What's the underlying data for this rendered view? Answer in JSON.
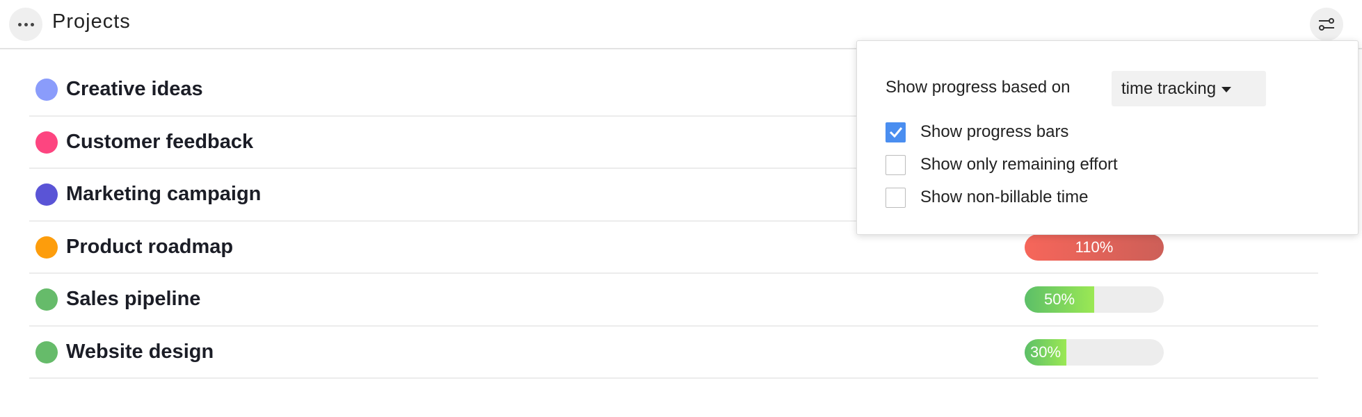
{
  "header": {
    "title": "Projects",
    "more_icon": "more-horizontal-icon",
    "settings_icon": "sliders-icon"
  },
  "projects": [
    {
      "name": "Creative ideas",
      "color": "#8a9cfb"
    },
    {
      "name": "Customer feedback",
      "color": "#fd4580"
    },
    {
      "name": "Marketing campaign",
      "color": "#5a54d6"
    },
    {
      "name": "Product roadmap",
      "color": "#fd9d0c",
      "progress": 110,
      "progress_label": "110%"
    },
    {
      "name": "Sales pipeline",
      "color": "#66bb6a",
      "progress": 50,
      "progress_label": "50%"
    },
    {
      "name": "Website design",
      "color": "#66bb6a",
      "progress": 30,
      "progress_label": "30%"
    }
  ],
  "popup": {
    "based_on_label": "Show progress based on",
    "based_on_value": "time tracking",
    "options": [
      {
        "label": "Show progress bars",
        "checked": true
      },
      {
        "label": "Show only remaining effort",
        "checked": false
      },
      {
        "label": "Show non-billable time",
        "checked": false
      }
    ]
  },
  "colors": {
    "over": "#f0645a",
    "ok_start": "#5cbf68",
    "ok_end": "#9be854",
    "accent": "#4a8ef0"
  }
}
